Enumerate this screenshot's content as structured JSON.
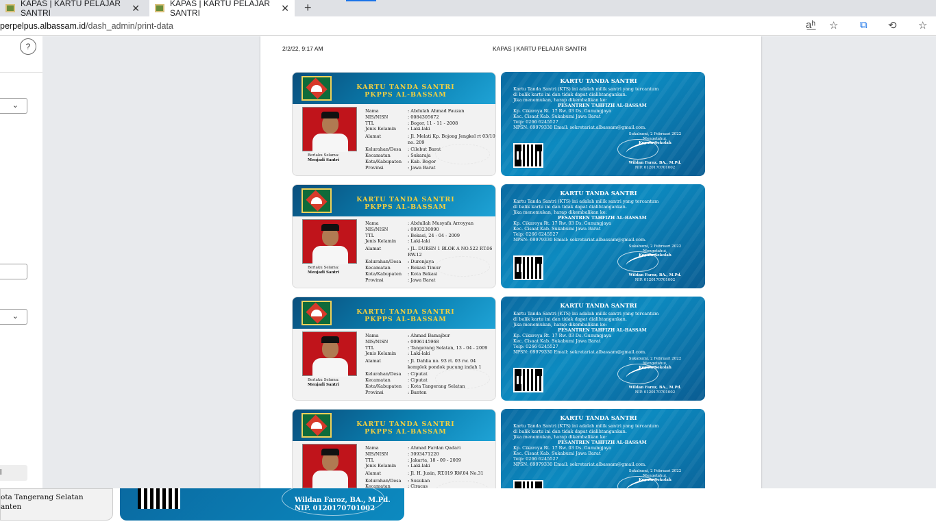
{
  "browser": {
    "tabs": [
      {
        "title": "KAPAS | KARTU PELAJAR SANTRI"
      },
      {
        "title": "KAPAS | KARTU PELAJAR SANTRI"
      }
    ],
    "close_glyph": "✕",
    "new_tab_glyph": "+",
    "url_host": "perpelpus.albassam.id",
    "url_path": "/dash_admin/print-data",
    "icons": [
      "read-aloud-icon",
      "favorites-add-icon",
      "collections-icon",
      "extensions-icon",
      "favorites-icon"
    ]
  },
  "print_panel": {
    "help": "?",
    "chev": "⌄"
  },
  "page": {
    "date": "2/2/22, 9:17 AM",
    "title": "KAPAS | KARTU PELAJAR SANTRI"
  },
  "card_front": {
    "title1": "KARTU TANDA SANTRI",
    "title2": "PKPPS AL-BASSAM",
    "berlaku": "Berlaku Selama:",
    "menjadi": "Menjadi Santri",
    "labels": {
      "nama": "Nama",
      "nis": "NIS/NISN",
      "ttl": "TTL",
      "jk": "Jenis Kelamin",
      "alamat": "Alamat",
      "kel": "Kelurahan/Desa",
      "kec": "Kecamatan",
      "kab": "Kota/Kabupaten",
      "prov": "Provinsi"
    }
  },
  "card_back": {
    "title": "KARTU TANDA SANTRI",
    "l1": "Kartu Tanda Santri (KTS) ini adalah milik santri yang tercantum",
    "l2": "di balik kartu ini dan tidak dapat dialihtangankan.",
    "l3": "Jika menemukan, harap dikembalikan ke:",
    "l4": "PESANTREN TAHFIZH AL-BASSAM",
    "l5": "Kp. Cikaroya Rt. 17 Rw. 03 Ds. Gunungjaya",
    "l6": "Kec. Cisaat Kab. Sukabumi Jawa Barat",
    "l7": "Telp: 0266 6245527",
    "l8": "NPSN: 69979330 Email: sekretariat.albassam@gmail.com.",
    "place_date": "Sukabumi, 2 Februari 2022",
    "mengetahui": "Mengetahui,",
    "kepala": "Kepala Sekolah",
    "signer": "Wildan Faroz, BA., M.Pd.",
    "nip": "NIP. 0120170701002"
  },
  "students": [
    {
      "nama": ": Abdulah Ahmad Fauzan",
      "nis": ": 0084305672",
      "ttl": ": Bogor, 11 - 11 - 2008",
      "jk": ": Laki-laki",
      "alamat": ": Jl. Melati Kp. Bojong Jengkol rt 03/10 no. 209",
      "kel": ": Cilebut Barat",
      "kec": ": Sukaraja",
      "kab": ": Kab. Bogor",
      "prov": ": Jawa Barat"
    },
    {
      "nama": ": Abdullah Musyafa Arroyyan",
      "nis": ": 0093230090",
      "ttl": ": Bekasi, 24 - 04 - 2009",
      "jk": ": Laki-laki",
      "alamat": ": JL. DUREN 1 BLOK A NO.522 RT.06 RW.12",
      "kel": ": Durenjaya",
      "kec": ": Bekasi Timur",
      "kab": ": Kota Bekasi",
      "prov": ": Jawa Barat"
    },
    {
      "nama": ": Ahmad Bamajbur",
      "nis": ": 0096145968",
      "ttl": ": Tangerang Selatan, 13 - 04 - 2009",
      "jk": ": Laki-laki",
      "alamat": ": Jl. Dahlia no. 93 rt. 03 rw. 04 komplek pondok pucung indah 1",
      "kel": ": Ciputat",
      "kec": ": Ciputat",
      "kab": ": Kota Tangerang Selatan",
      "prov": ": Banten"
    },
    {
      "nama": ": Ahmad Fardan Qadari",
      "nis": ": 3093471220",
      "ttl": ": Jakarta, 18 - 09 - 2009",
      "jk": ": Laki-laki",
      "alamat": ": Jl. H. Jusin, RT.019 RW.04 No.31",
      "kel": ": Susukan",
      "kec": ": Ciracas",
      "kab": "",
      "prov": ""
    }
  ],
  "overlay": {
    "left_line1": "ota Tangerang Selatan",
    "left_line2": "anten",
    "right_signer": "Wildan Faroz, BA., M.Pd.",
    "right_nip": "NIP. 0120170701002"
  }
}
